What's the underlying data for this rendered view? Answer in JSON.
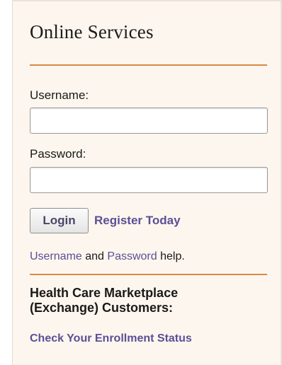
{
  "panel": {
    "title": "Online Services"
  },
  "login": {
    "username_label": "Username:",
    "username_value": "",
    "password_label": "Password:",
    "password_value": "",
    "login_button": "Login",
    "register_link": "Register Today"
  },
  "help": {
    "username_link": "Username",
    "and_text": " and ",
    "password_link": "Password",
    "suffix_text": " help."
  },
  "marketplace": {
    "heading_line1": "Health Care Marketplace",
    "heading_line2": "(Exchange) Customers:",
    "status_link": "Check Your Enrollment Status"
  },
  "colors": {
    "panel_background": "#fdf6ee",
    "divider": "#d98a45",
    "link": "#5a4f96"
  }
}
